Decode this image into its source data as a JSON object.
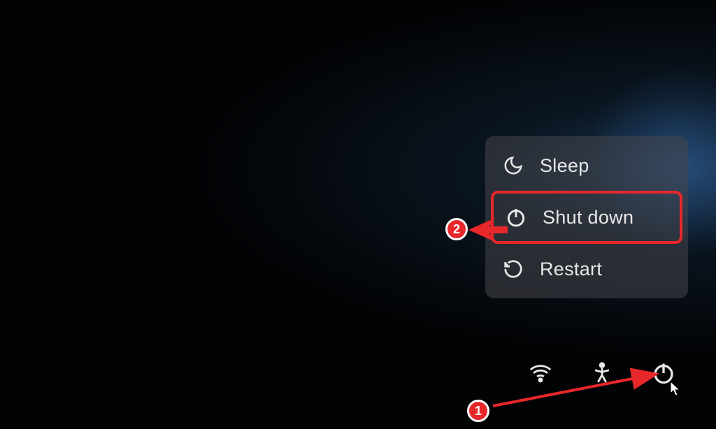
{
  "power_menu": {
    "items": [
      {
        "label": "Sleep",
        "icon": "moon-icon"
      },
      {
        "label": "Shut down",
        "icon": "power-icon"
      },
      {
        "label": "Restart",
        "icon": "restart-icon"
      }
    ]
  },
  "taskbar": {
    "icons": [
      {
        "name": "wifi-icon"
      },
      {
        "name": "accessibility-icon"
      },
      {
        "name": "power-icon"
      }
    ]
  },
  "annotations": {
    "badge_1": "1",
    "badge_2": "2"
  }
}
